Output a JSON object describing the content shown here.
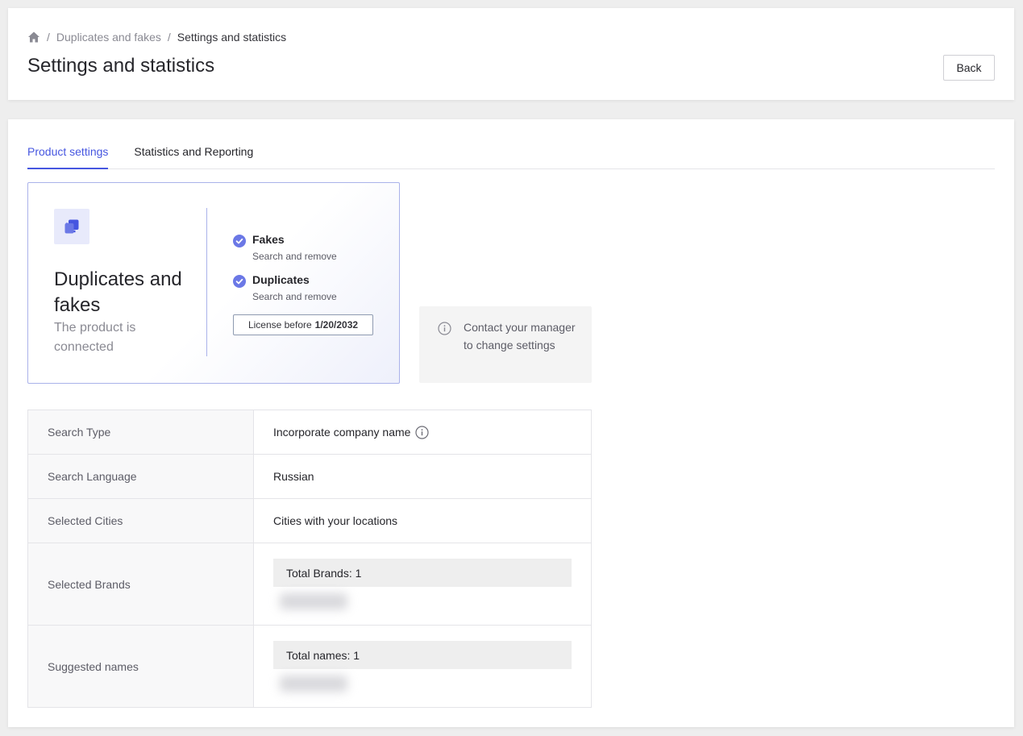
{
  "breadcrumb": {
    "items": [
      "Duplicates and fakes",
      "Settings and statistics"
    ],
    "separator": "/"
  },
  "header": {
    "title": "Settings and statistics",
    "back_label": "Back"
  },
  "tabs": [
    {
      "label": "Product settings",
      "active": true
    },
    {
      "label": "Statistics and Reporting",
      "active": false
    }
  ],
  "product": {
    "name": "Duplicates and fakes",
    "status": "The product is connected",
    "features": [
      {
        "title": "Fakes",
        "description": "Search and remove"
      },
      {
        "title": "Duplicates",
        "description": "Search and remove"
      }
    ],
    "license_prefix": "License before",
    "license_date": "1/20/2032"
  },
  "contact_note": "Contact your manager to change settings",
  "settings": {
    "search_type": {
      "label": "Search Type",
      "value": "Incorporate company name"
    },
    "search_language": {
      "label": "Search Language",
      "value": "Russian"
    },
    "selected_cities": {
      "label": "Selected Cities",
      "value": "Cities with your locations"
    },
    "selected_brands": {
      "label": "Selected Brands",
      "total": "Total Brands: 1"
    },
    "suggested_names": {
      "label": "Suggested names",
      "total": "Total names: 1"
    }
  },
  "colors": {
    "accent": "#4656e0",
    "check": "#6b78e6",
    "page_bg": "#eeeeee"
  },
  "icons": [
    "home-icon",
    "copy-icon",
    "check-circle-icon",
    "info-icon"
  ]
}
